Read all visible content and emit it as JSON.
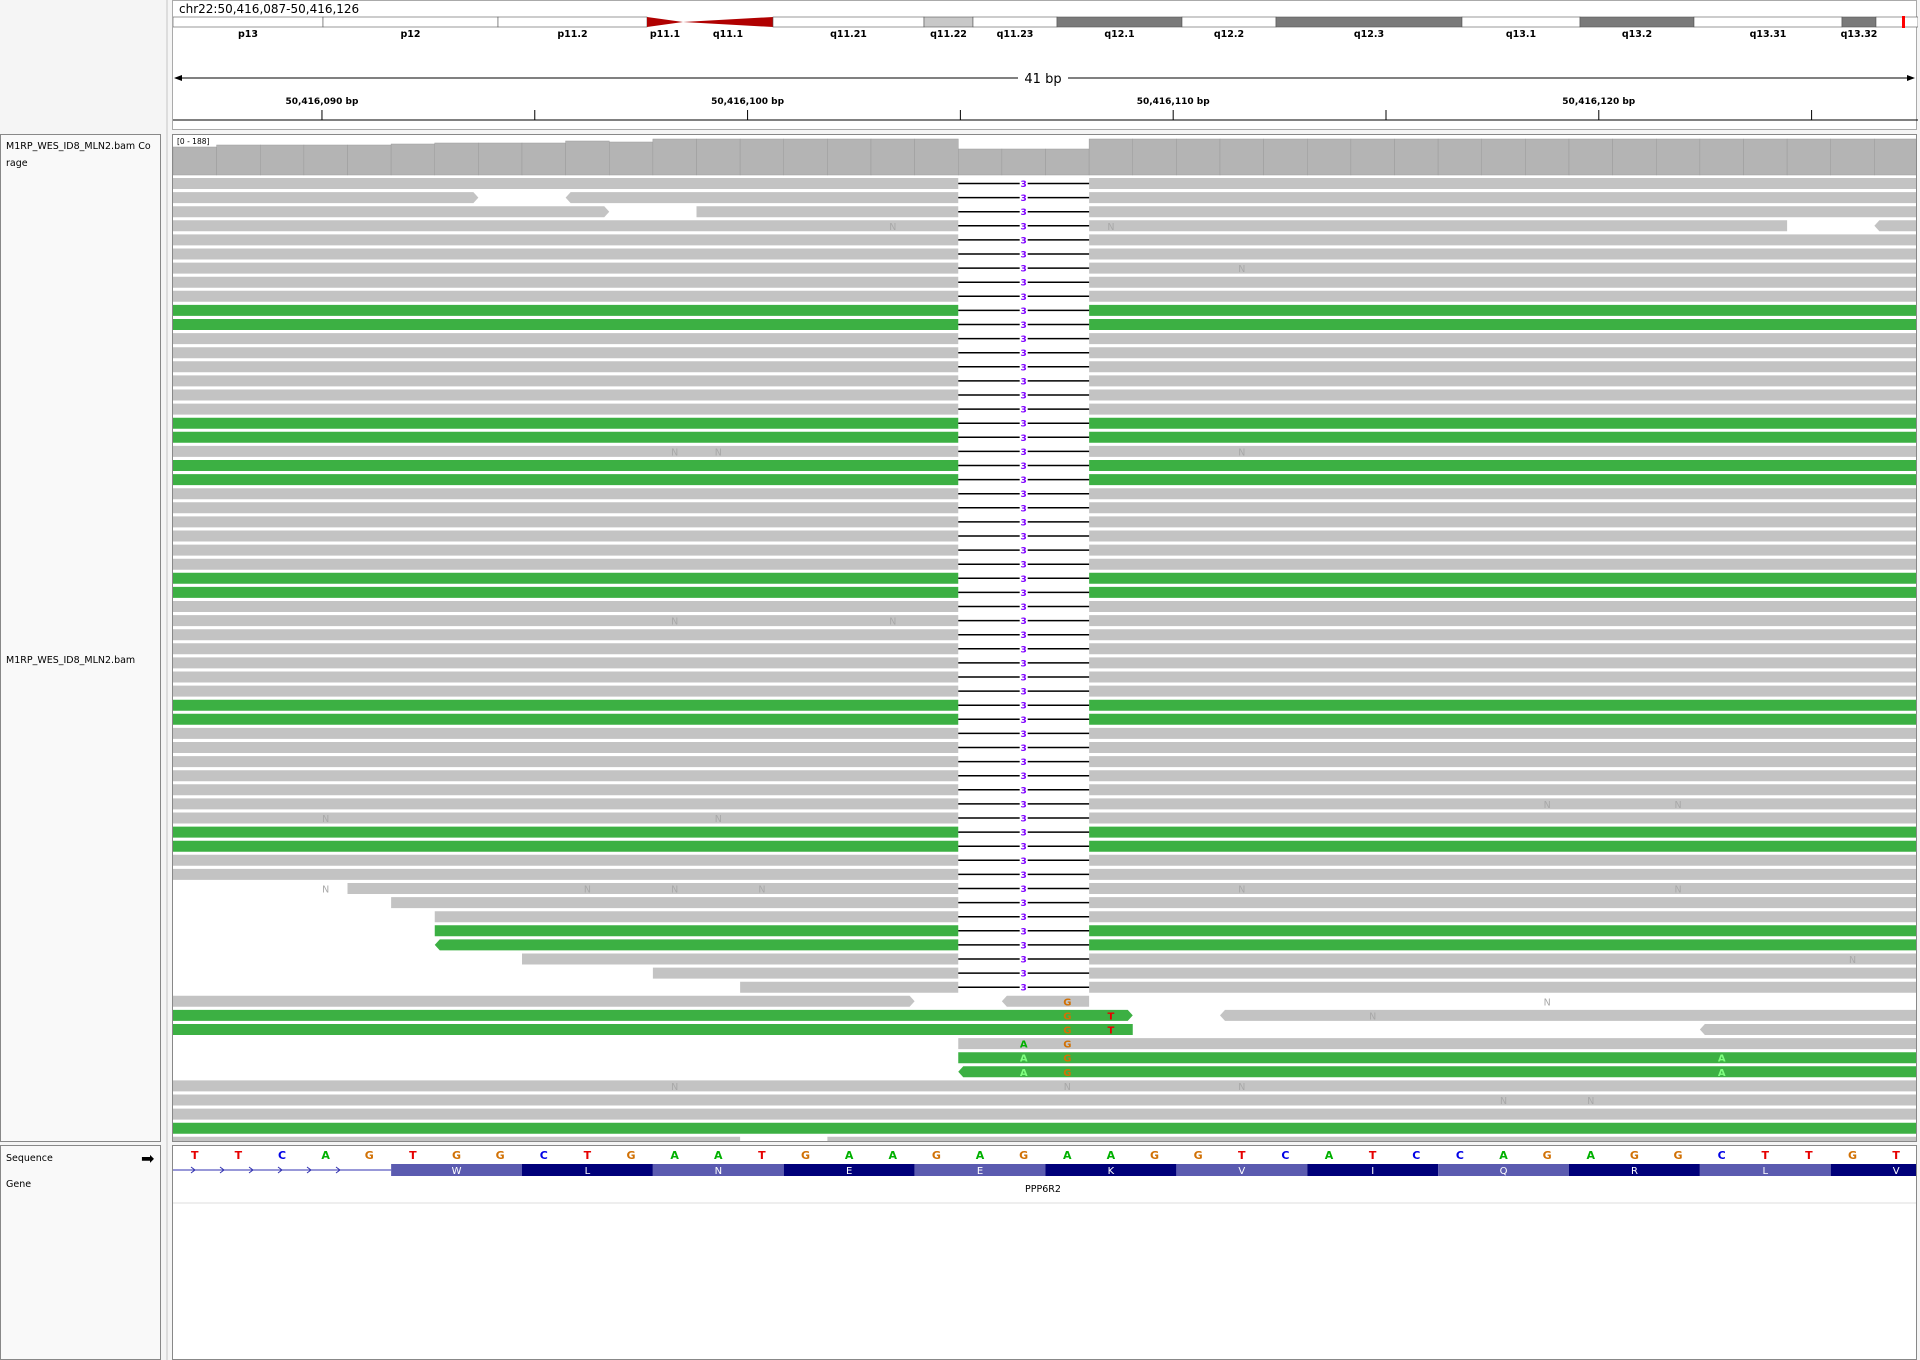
{
  "locus": "chr22:50,416,087-50,416,126",
  "ideogram": {
    "bands": [
      {
        "name": "p13",
        "stain": "white"
      },
      {
        "name": "p12",
        "stain": "white"
      },
      {
        "name": "p11.2",
        "stain": "white"
      },
      {
        "name": "p11.1",
        "stain": "acen"
      },
      {
        "name": "q11.1",
        "stain": "acen"
      },
      {
        "name": "q11.21",
        "stain": "white"
      },
      {
        "name": "q11.22",
        "stain": "lightgray"
      },
      {
        "name": "q11.23",
        "stain": "white"
      },
      {
        "name": "q12.1",
        "stain": "gray"
      },
      {
        "name": "q12.2",
        "stain": "white"
      },
      {
        "name": "q12.3",
        "stain": "gray"
      },
      {
        "name": "q13.1",
        "stain": "white"
      },
      {
        "name": "q13.2",
        "stain": "gray"
      },
      {
        "name": "q13.31",
        "stain": "white"
      },
      {
        "name": "q13.32",
        "stain": "gray"
      }
    ]
  },
  "ruler": {
    "span_label": "41 bp",
    "ticks": [
      "50,416,090 bp",
      "50,416,100 bp",
      "50,416,110 bp",
      "50,416,120 bp"
    ]
  },
  "tracks": {
    "coverage_name": "M1RP_WES_ID8_MLN2.bam Coverage",
    "coverage_name_line1": "M1RP_WES_ID8_MLN2.bam Co",
    "coverage_name_line2": "rage",
    "coverage_range": "[0 - 188]",
    "alignment_name": "M1RP_WES_ID8_MLN2.bam",
    "sequence_label": "Sequence",
    "gene_label": "Gene"
  },
  "deletion_label": "3",
  "sequence": [
    "T",
    "T",
    "C",
    "A",
    "G",
    "T",
    "G",
    "G",
    "C",
    "T",
    "G",
    "A",
    "A",
    "T",
    "G",
    "A",
    "A",
    "G",
    "A",
    "G",
    "A",
    "A",
    "G",
    "G",
    "T",
    "C",
    "A",
    "T",
    "C",
    "C",
    "A",
    "G",
    "A",
    "G",
    "G",
    "C",
    "T",
    "T",
    "G",
    "T"
  ],
  "gene": {
    "name": "PPP6R2",
    "amino_acids": [
      "W",
      "L",
      "N",
      "E",
      "E",
      "K",
      "V",
      "I",
      "Q",
      "R",
      "L",
      "V"
    ]
  },
  "colors": {
    "A": "#00b000",
    "C": "#0000e6",
    "G": "#d17105",
    "T": "#e60000",
    "read_gray": "#c3c3c3",
    "read_green": "#3cb043",
    "deletion_count": "#7f00ff",
    "centromere": "#b00000",
    "gene_block_light": "#5b5bb0",
    "gene_block_dark": "#00007a"
  }
}
